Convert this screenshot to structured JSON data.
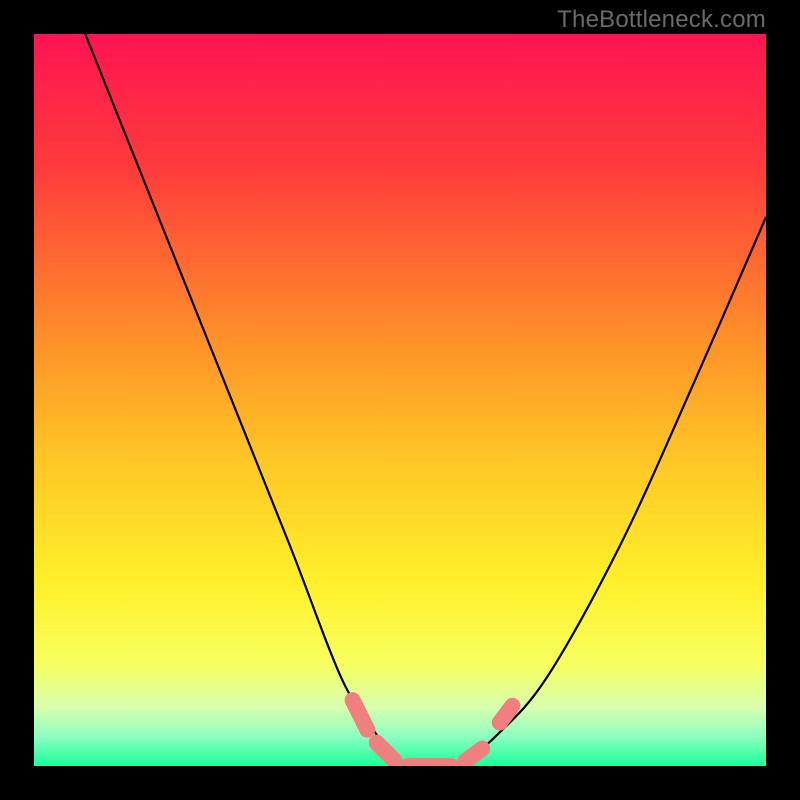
{
  "watermark": "TheBottleneck.com",
  "chart_data": {
    "type": "line",
    "title": "",
    "xlabel": "",
    "ylabel": "",
    "xlim": [
      0,
      100
    ],
    "ylim": [
      0,
      100
    ],
    "series": [
      {
        "name": "left-curve",
        "x": [
          7,
          15,
          25,
          35,
          42,
          47,
          50
        ],
        "y": [
          100,
          80,
          55,
          30,
          12,
          4,
          0
        ]
      },
      {
        "name": "right-curve",
        "x": [
          58,
          63,
          70,
          80,
          90,
          100
        ],
        "y": [
          0,
          4,
          12,
          30,
          52,
          75
        ]
      }
    ],
    "marker_segments": [
      {
        "x1": 43,
        "y1": 10,
        "x2": 46,
        "y2": 4
      },
      {
        "x1": 46,
        "y1": 4,
        "x2": 50,
        "y2": 0
      },
      {
        "x1": 50,
        "y1": 0,
        "x2": 58,
        "y2": 0
      },
      {
        "x1": 58,
        "y1": 0,
        "x2": 62,
        "y2": 3
      },
      {
        "x1": 63,
        "y1": 5,
        "x2": 66,
        "y2": 9
      }
    ],
    "gradient_stops": [
      {
        "offset": 0,
        "color": "#ff1452"
      },
      {
        "offset": 18,
        "color": "#ff3a3c"
      },
      {
        "offset": 40,
        "color": "#ff8a2a"
      },
      {
        "offset": 58,
        "color": "#ffc625"
      },
      {
        "offset": 75,
        "color": "#fff02a"
      },
      {
        "offset": 86,
        "color": "#f7ff5e"
      },
      {
        "offset": 92,
        "color": "#d8ffb0"
      },
      {
        "offset": 96,
        "color": "#8cffc0"
      },
      {
        "offset": 100,
        "color": "#1aff9a"
      }
    ]
  }
}
